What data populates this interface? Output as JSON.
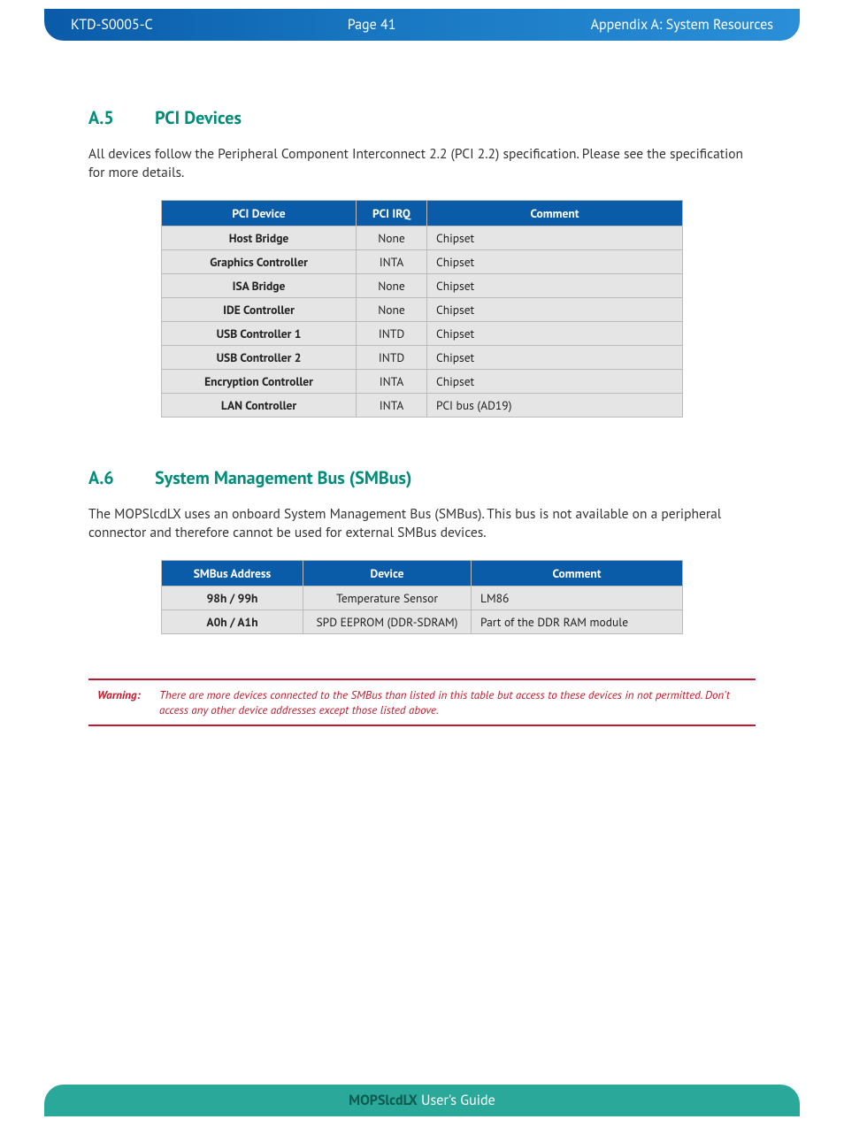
{
  "header": {
    "doc_id": "KTD-S0005-C",
    "page": "Page 41",
    "appendix": "Appendix A: System Resources"
  },
  "sectionA5": {
    "num": "A.5",
    "title": "PCI Devices",
    "text": "All devices follow the Peripheral Component Interconnect 2.2 (PCI 2.2) specification. Please see the specification for more details.",
    "headers": {
      "c1": "PCI Device",
      "c2": "PCI IRQ",
      "c3": "Comment"
    },
    "rows": [
      {
        "device": "Host Bridge",
        "irq": "None",
        "comment": "Chipset"
      },
      {
        "device": "Graphics Controller",
        "irq": "INTA",
        "comment": "Chipset"
      },
      {
        "device": "ISA Bridge",
        "irq": "None",
        "comment": "Chipset"
      },
      {
        "device": "IDE Controller",
        "irq": "None",
        "comment": "Chipset"
      },
      {
        "device": "USB Controller 1",
        "irq": "INTD",
        "comment": "Chipset"
      },
      {
        "device": "USB Controller 2",
        "irq": "INTD",
        "comment": "Chipset"
      },
      {
        "device": "Encryption Controller",
        "irq": "INTA",
        "comment": "Chipset"
      },
      {
        "device": "LAN Controller",
        "irq": "INTA",
        "comment": "PCI bus (AD19)"
      }
    ]
  },
  "sectionA6": {
    "num": "A.6",
    "title": "System Management Bus (SMBus)",
    "text": "The MOPSlcdLX uses an onboard System Management Bus (SMBus). This bus is not available on a peripheral connector and therefore cannot be used for external SMBus devices.",
    "headers": {
      "c1": "SMBus Address",
      "c2": "Device",
      "c3": "Comment"
    },
    "rows": [
      {
        "addr": "98h / 99h",
        "device": "Temperature Sensor",
        "comment": "LM86"
      },
      {
        "addr": "A0h / A1h",
        "device": "SPD EEPROM (DDR-SDRAM)",
        "comment": "Part of the DDR RAM module"
      }
    ]
  },
  "warning": {
    "label": "Warning:",
    "text": "There are more devices connected to the SMBus than listed in this table but access to these devices in not permitted. Don't access any other device addresses except those listed above."
  },
  "footer": {
    "bold": "MOPSlcdLX",
    "rest": " User's Guide"
  }
}
